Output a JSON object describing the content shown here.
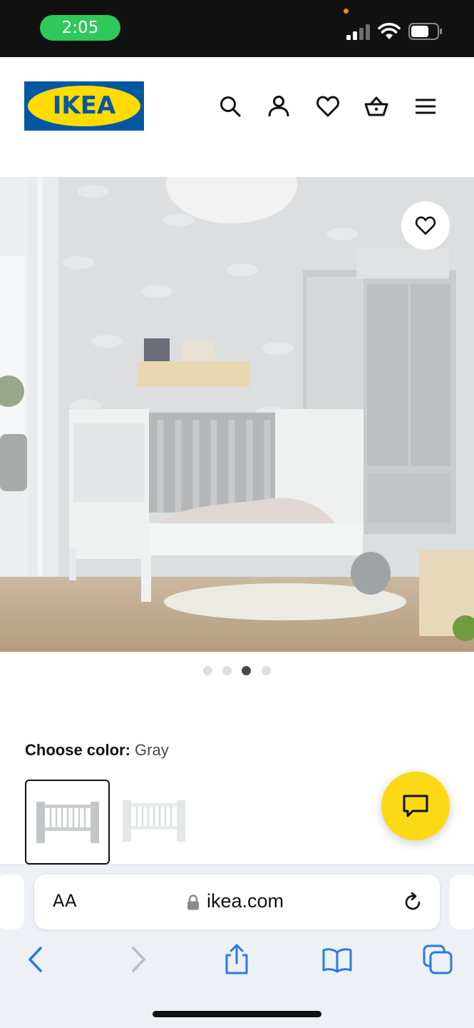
{
  "status_bar": {
    "time": "2:05",
    "icons": [
      "signal-icon",
      "wifi-icon",
      "battery-icon"
    ]
  },
  "header": {
    "logo_text": "IKEA",
    "icons": [
      "search-icon",
      "account-icon",
      "heart-icon",
      "cart-icon",
      "menu-icon"
    ],
    "brand_blue": "#0058a3",
    "brand_yellow": "#ffdb00"
  },
  "hero": {
    "favorite_icon": "heart-icon",
    "carousel": {
      "count": 4,
      "active_index": 2
    }
  },
  "color_chooser": {
    "label": "Choose color:",
    "value": "Gray",
    "swatches": [
      {
        "name": "gray",
        "selected": true
      },
      {
        "name": "white",
        "selected": false
      }
    ]
  },
  "chat_button": {
    "icon": "chat-icon",
    "color": "#fbd914"
  },
  "browser": {
    "text_size_label": "AA",
    "url": "ikea.com",
    "toolbar_icons": [
      "back-icon",
      "forward-icon",
      "share-icon",
      "bookmarks-icon",
      "tabs-icon"
    ]
  }
}
